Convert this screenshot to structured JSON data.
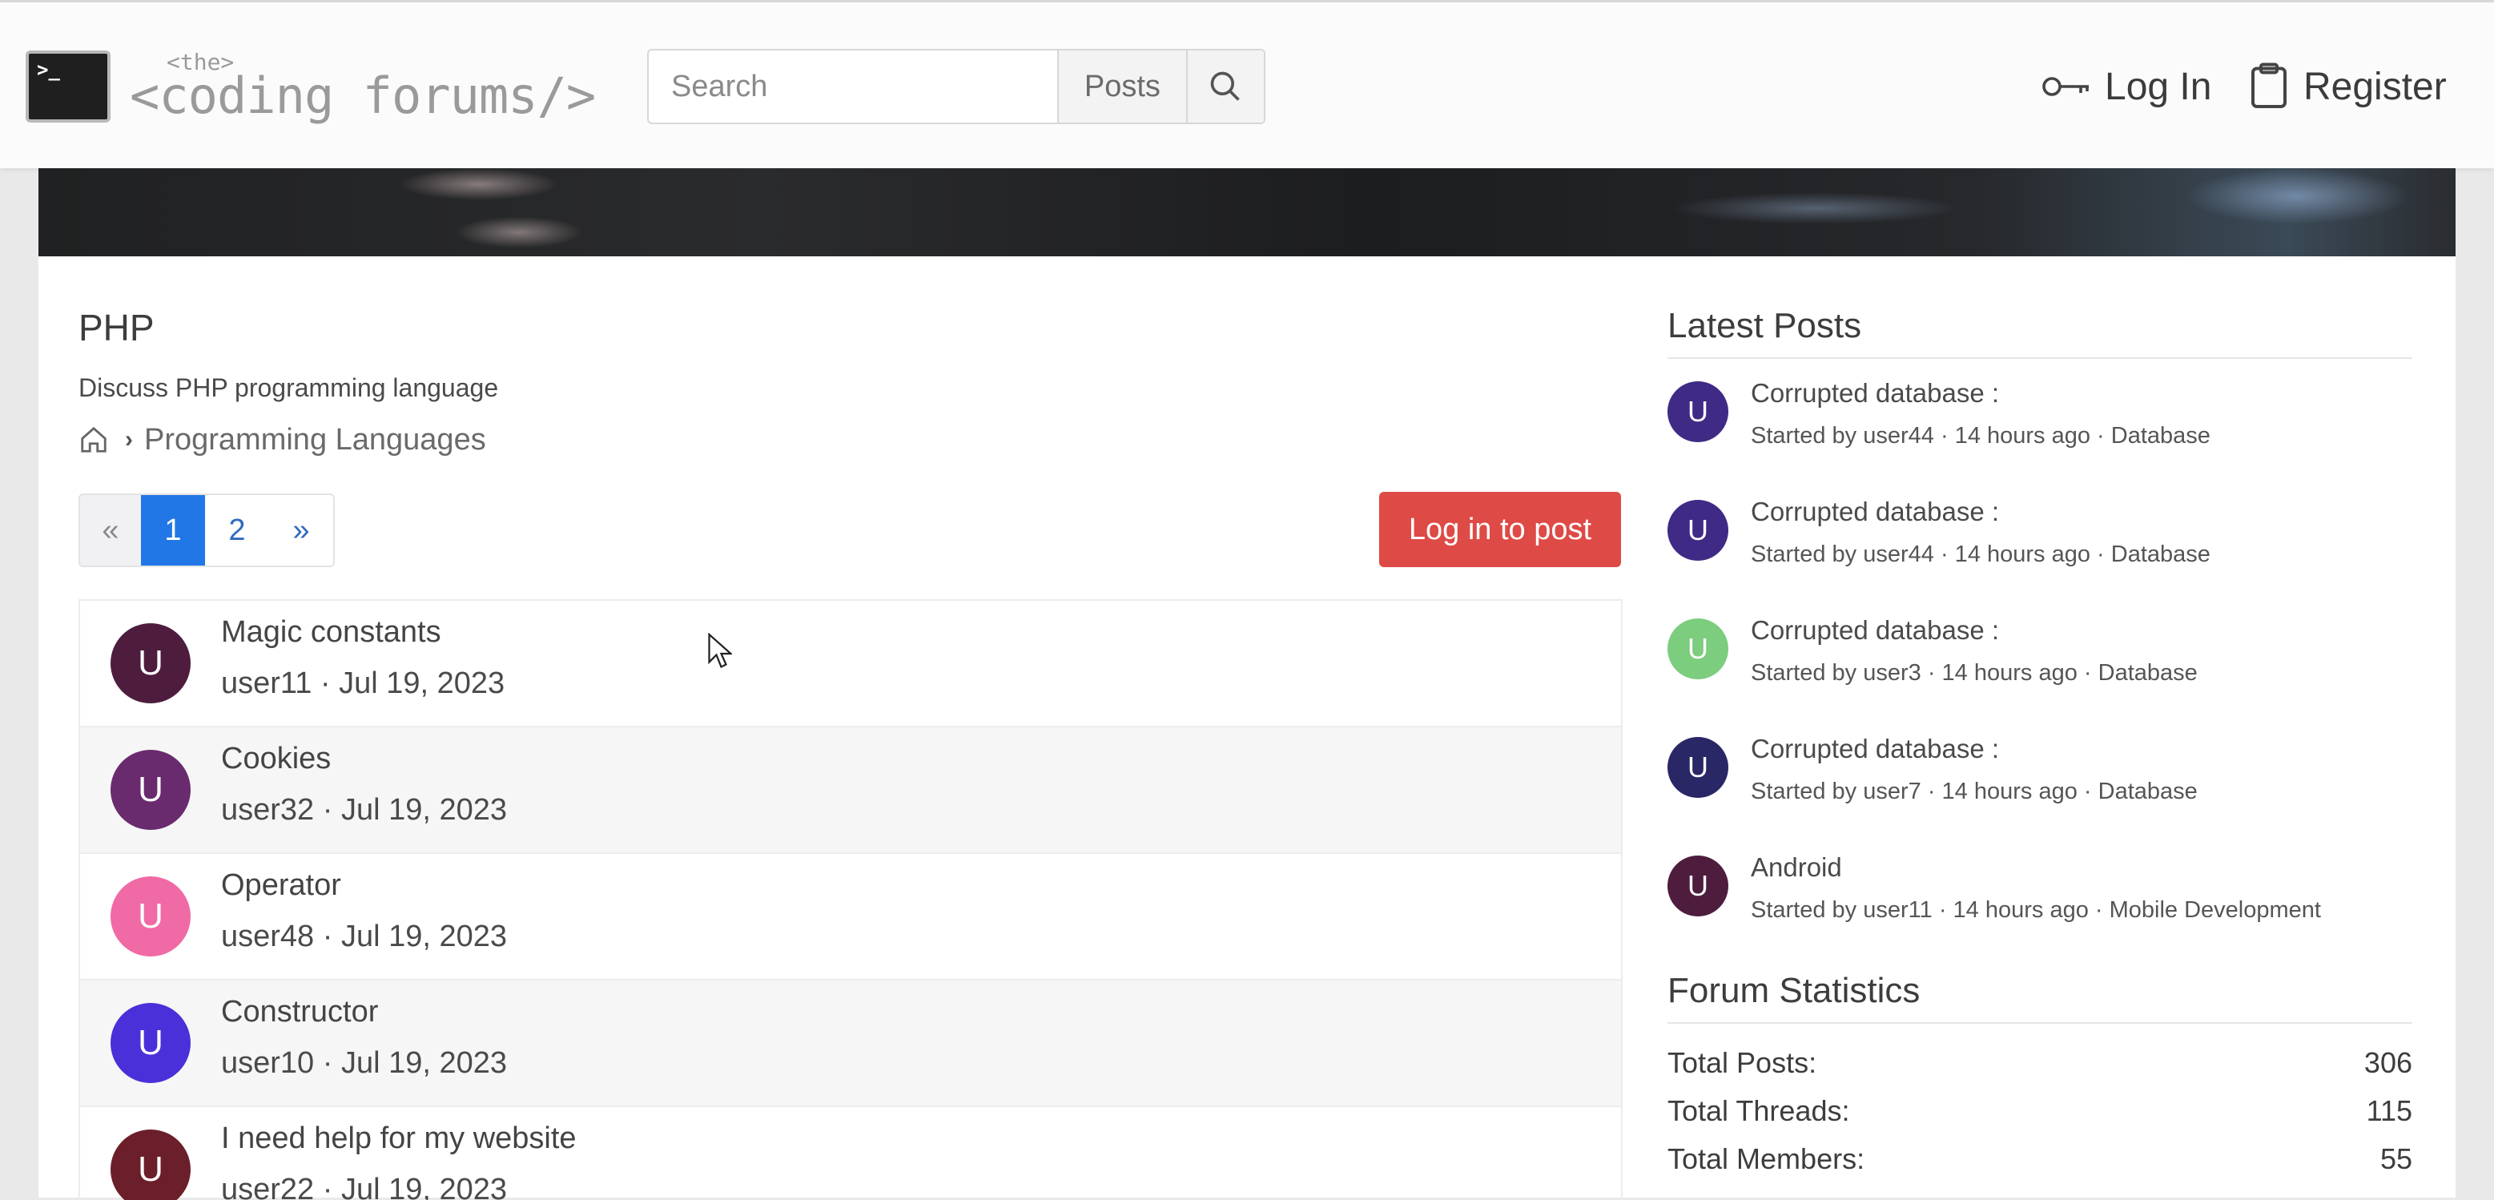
{
  "header": {
    "logo_prompt": ">_",
    "logo_small": "<the>",
    "logo_main": "<coding forums/>",
    "search_placeholder": "Search",
    "search_scope": "Posts",
    "login_label": "Log In",
    "register_label": "Register"
  },
  "forum": {
    "title": "PHP",
    "description": "Discuss PHP programming language",
    "breadcrumb": [
      "Programming Languages"
    ]
  },
  "pagination": {
    "prev": "«",
    "pages": [
      "1",
      "2"
    ],
    "next": "»",
    "current": "1"
  },
  "actions": {
    "login_to_post": "Log in to post"
  },
  "threads": [
    {
      "title": "Magic constants",
      "meta": "user11 · Jul 19, 2023",
      "avatar": "U",
      "color": "#4e1d3e"
    },
    {
      "title": "Cookies",
      "meta": "user32 · Jul 19, 2023",
      "avatar": "U",
      "color": "#6a2b6e"
    },
    {
      "title": "Operator",
      "meta": "user48 · Jul 19, 2023",
      "avatar": "U",
      "color": "#f06aa6"
    },
    {
      "title": "Constructor",
      "meta": "user10 · Jul 19, 2023",
      "avatar": "U",
      "color": "#4a30d9"
    },
    {
      "title": "I need help for my website",
      "meta": "user22 · Jul 19, 2023",
      "avatar": "U",
      "color": "#6b1f2a"
    }
  ],
  "sidebar": {
    "latest_heading": "Latest Posts",
    "latest_posts": [
      {
        "title": "Corrupted database :",
        "meta": "Started by user44 · 14 hours ago · Database",
        "avatar": "U",
        "color": "#3f2a86"
      },
      {
        "title": "Corrupted database :",
        "meta": "Started by user44 · 14 hours ago · Database",
        "avatar": "U",
        "color": "#3f2a86"
      },
      {
        "title": "Corrupted database :",
        "meta": "Started by user3 · 14 hours ago · Database",
        "avatar": "U",
        "color": "#7ccd7e"
      },
      {
        "title": "Corrupted database :",
        "meta": "Started by user7 · 14 hours ago · Database",
        "avatar": "U",
        "color": "#2a2766"
      },
      {
        "title": "Android",
        "meta": "Started by user11 · 14 hours ago · Mobile Development",
        "avatar": "U",
        "color": "#4e1d3e"
      }
    ],
    "stats_heading": "Forum Statistics",
    "stats": [
      {
        "label": "Total Posts:",
        "value": "306"
      },
      {
        "label": "Total Threads:",
        "value": "115"
      },
      {
        "label": "Total Members:",
        "value": "55"
      }
    ]
  },
  "colors": {
    "accent": "#2277e6",
    "danger": "#de4a45"
  }
}
